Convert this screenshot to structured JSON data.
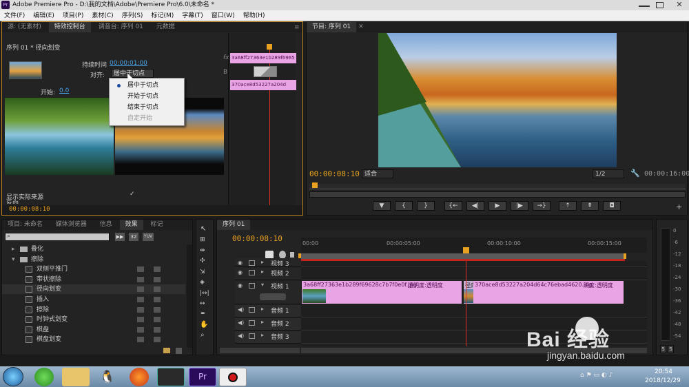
{
  "window": {
    "app_icon": "Pr",
    "title": "Adobe Premiere Pro - D:\\我的文档\\Adobe\\Premiere Pro\\6.0\\未命名 *"
  },
  "menu": [
    "文件(F)",
    "编辑(E)",
    "项目(P)",
    "素材(C)",
    "序列(S)",
    "标记(M)",
    "字幕(T)",
    "窗口(W)",
    "帮助(H)"
  ],
  "source_panel": {
    "tabs": [
      "源: (无素材)",
      "特效控制台",
      "调音台: 序列 01",
      "元数据"
    ],
    "active_tab": 1,
    "sequence_label": "序列 01 * 径向划变",
    "duration_label": "持续时间",
    "duration_value": "00:00:01:00",
    "align_label": "对齐:",
    "align_value": "居中于切点",
    "start_label": "开始:",
    "start_value": "0.0",
    "show_actual": "显示实际来源",
    "reverse_partial": "反向",
    "timecode": "00:00:08:10",
    "fx_label": "fx",
    "b_label": "B",
    "clip_a": "3a68ff27363e1b289f6965",
    "clip_b": "370ace8d53227a204d",
    "dropdown": {
      "items": [
        "居中于切点",
        "开始于切点",
        "结束于切点",
        "自定开始"
      ],
      "selected": 0,
      "disabled": 3
    }
  },
  "program_panel": {
    "tab": "节目: 序列 01",
    "timecode": "00:00:08:10",
    "fit": "适合",
    "quality": "1/2",
    "duration": "00:00:16:00"
  },
  "transport": {
    "buttons": [
      "marker",
      "in-point",
      "out-point",
      "go-to-in",
      "step-back",
      "play",
      "step-forward",
      "go-to-out",
      "lift",
      "extract",
      "export-frame"
    ]
  },
  "project_panel": {
    "tabs": [
      "项目: 未命名",
      "媒体浏览器",
      "信息",
      "效果",
      "标记"
    ],
    "active_tab": 3,
    "chips": [
      "32",
      "YUV"
    ],
    "tree": [
      {
        "label": "叠化",
        "type": "folder",
        "level": 0,
        "open": false
      },
      {
        "label": "擦除",
        "type": "folder",
        "level": 0,
        "open": true
      },
      {
        "label": "双侧平推门",
        "type": "fx",
        "level": 1
      },
      {
        "label": "带状擦除",
        "type": "fx",
        "level": 1
      },
      {
        "label": "径向划变",
        "type": "fx",
        "level": 1,
        "selected": true
      },
      {
        "label": "插入",
        "type": "fx",
        "level": 1
      },
      {
        "label": "擦除",
        "type": "fx",
        "level": 1
      },
      {
        "label": "时钟式划变",
        "type": "fx",
        "level": 1
      },
      {
        "label": "棋盘",
        "type": "fx",
        "level": 1
      },
      {
        "label": "棋盘划变",
        "type": "fx",
        "level": 1
      }
    ]
  },
  "timeline": {
    "tab": "序列 01",
    "timecode": "00:00:08:10",
    "ruler": [
      "00:00",
      "00:00:05:00",
      "00:00:10:00",
      "00:00:15:00"
    ],
    "tracks": [
      {
        "name": "视频 3",
        "type": "video"
      },
      {
        "name": "视频 2",
        "type": "video"
      },
      {
        "name": "视频 1",
        "type": "video"
      },
      {
        "name": "音频 1",
        "type": "audio"
      },
      {
        "name": "音频 2",
        "type": "audio"
      },
      {
        "name": "音频 3",
        "type": "audio"
      }
    ],
    "clip1": "3a68ff27363e1b289f69628c7b7f0e0f.jpg",
    "clip1_fx": "透明度:透明度",
    "transition": "径向划",
    "clip2": "370ace8d53227a204d64c76ebad4620.jpg",
    "clip2_fx": "明度:透明度"
  },
  "meter": {
    "scale": [
      "0",
      "-6",
      "-12",
      "-18",
      "-24",
      "-30",
      "-36",
      "-42",
      "-48",
      "-54"
    ],
    "solo": [
      "S",
      "S"
    ]
  },
  "taskbar": {
    "clock": "20:54",
    "date": "2018/12/29"
  },
  "watermark": {
    "text": "Bai 经验",
    "url": "jingyan.baidu.com"
  },
  "colors": {
    "accent_orange": "#e8a220",
    "accent_blue": "#4aa3e6",
    "clip_pink": "#e8a4e4",
    "playhead": "#e0321e"
  }
}
